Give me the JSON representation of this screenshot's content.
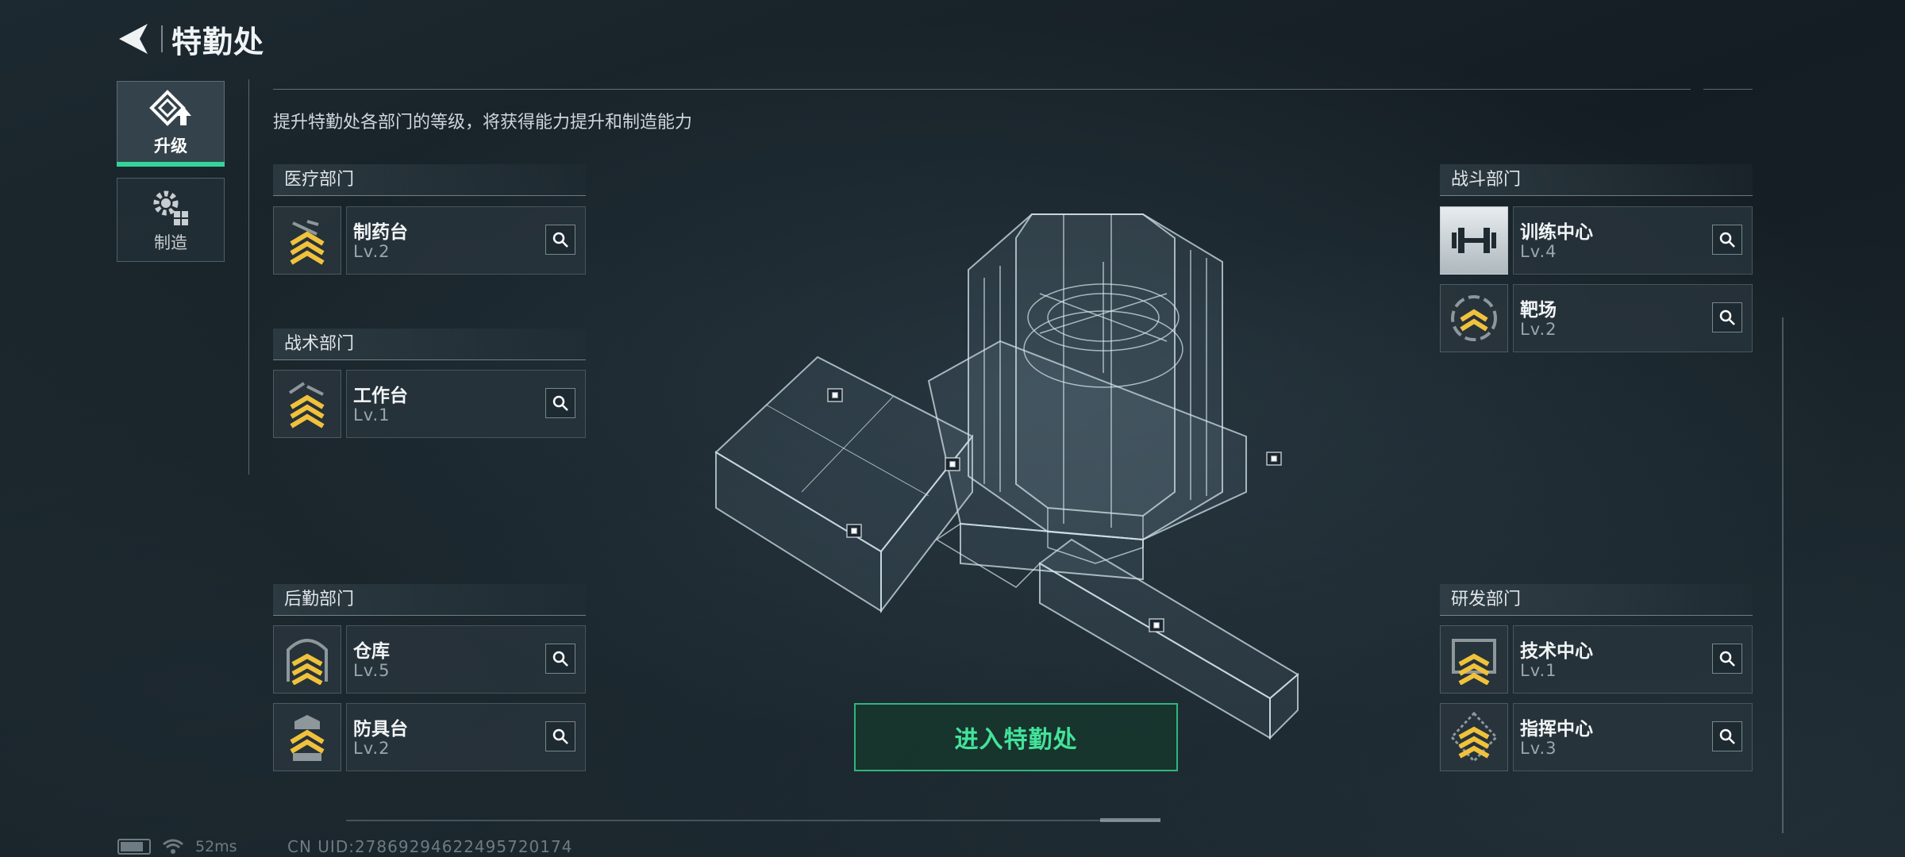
{
  "header": {
    "title": "特勤处"
  },
  "tabs": [
    {
      "label": "升级",
      "active": true,
      "icon": "upgrade-icon"
    },
    {
      "label": "制造",
      "active": false,
      "icon": "gear-icon"
    }
  ],
  "description": "提升特勤处各部门的等级，将获得能力提升和制造能力",
  "departments": {
    "medical": {
      "title": "医疗部门",
      "facilities": [
        {
          "name": "制药台",
          "level": "Lv.2",
          "icon": "pharmacy-chevrons-icon"
        }
      ]
    },
    "tactical": {
      "title": "战术部门",
      "facilities": [
        {
          "name": "工作台",
          "level": "Lv.1",
          "icon": "workbench-chevrons-icon"
        }
      ]
    },
    "logistics": {
      "title": "后勤部门",
      "facilities": [
        {
          "name": "仓库",
          "level": "Lv.5",
          "icon": "warehouse-chevrons-icon"
        },
        {
          "name": "防具台",
          "level": "Lv.2",
          "icon": "armor-bench-chevrons-icon"
        }
      ]
    },
    "combat": {
      "title": "战斗部门",
      "facilities": [
        {
          "name": "训练中心",
          "level": "Lv.4",
          "icon": "dumbbell-icon"
        },
        {
          "name": "靶场",
          "level": "Lv.2",
          "icon": "target-chevrons-icon"
        }
      ]
    },
    "research": {
      "title": "研发部门",
      "facilities": [
        {
          "name": "技术中心",
          "level": "Lv.1",
          "icon": "tech-chevrons-icon"
        },
        {
          "name": "指挥中心",
          "level": "Lv.3",
          "icon": "command-chevrons-icon"
        }
      ]
    }
  },
  "enter_button": "进入特勤处",
  "status": {
    "ping": "52ms",
    "uid": "CN UID:278692946224957201​74"
  },
  "colors": {
    "accent_green": "#34d39a",
    "chevron_yellow": "#f0c23c",
    "background": "#172127"
  }
}
